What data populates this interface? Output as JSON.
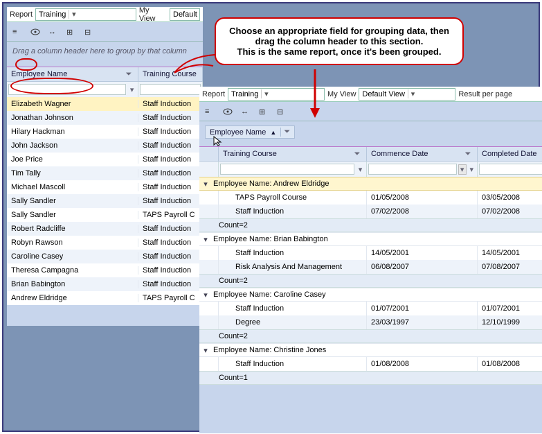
{
  "callout": {
    "line1": "Choose an appropriate field for grouping data, then",
    "line2": "drag the column header to this section.",
    "line3": "This is the same report, once it's been grouped."
  },
  "left": {
    "reportLabel": "Report",
    "reportValue": "Training",
    "myViewLabel": "My View",
    "myViewValue": "Default",
    "groupHint": "Drag a column header here to group by that column",
    "columns": {
      "c1": "Employee Name",
      "c2": "Training Course"
    },
    "rows": [
      {
        "name": "Elizabeth Wagner",
        "course": "Staff Induction"
      },
      {
        "name": "Jonathan Johnson",
        "course": "Staff Induction"
      },
      {
        "name": "Hilary Hackman",
        "course": "Staff Induction"
      },
      {
        "name": "John Jackson",
        "course": "Staff Induction"
      },
      {
        "name": "Joe Price",
        "course": "Staff Induction"
      },
      {
        "name": "Tim Tally",
        "course": "Staff Induction"
      },
      {
        "name": "Michael Mascoll",
        "course": "Staff Induction"
      },
      {
        "name": "Sally Sandler",
        "course": "Staff Induction"
      },
      {
        "name": "Sally Sandler",
        "course": "TAPS Payroll C"
      },
      {
        "name": "Robert Radcliffe",
        "course": "Staff Induction"
      },
      {
        "name": "Robyn Rawson",
        "course": "Staff Induction"
      },
      {
        "name": "Caroline Casey",
        "course": "Staff Induction"
      },
      {
        "name": "Theresa Campagna",
        "course": "Staff Induction"
      },
      {
        "name": "Brian Babington",
        "course": "Staff Induction"
      },
      {
        "name": "Andrew Eldridge",
        "course": "TAPS Payroll C"
      }
    ]
  },
  "right": {
    "reportLabel": "Report",
    "reportValue": "Training",
    "myViewLabel": "My View",
    "myViewValue": "Default View",
    "resultLabel": "Result per page",
    "groupedBy": "Employee Name",
    "sortIndicator": "▲",
    "columns": {
      "c1": "Training Course",
      "c2": "Commence Date",
      "c3": "Completed Date"
    },
    "groups": [
      {
        "label": "Employee Name: Andrew Eldridge",
        "highlighted": true,
        "rows": [
          {
            "course": "TAPS Payroll Course",
            "start": "01/05/2008",
            "end": "03/05/2008"
          },
          {
            "course": "Staff Induction",
            "start": "07/02/2008",
            "end": "07/02/2008"
          }
        ],
        "count": "Count=2"
      },
      {
        "label": "Employee Name: Brian Babington",
        "rows": [
          {
            "course": "Staff Induction",
            "start": "14/05/2001",
            "end": "14/05/2001"
          },
          {
            "course": "Risk Analysis And Management",
            "start": "06/08/2007",
            "end": "07/08/2007"
          }
        ],
        "count": "Count=2"
      },
      {
        "label": "Employee Name: Caroline Casey",
        "rows": [
          {
            "course": "Staff Induction",
            "start": "01/07/2001",
            "end": "01/07/2001"
          },
          {
            "course": "Degree",
            "start": "23/03/1997",
            "end": "12/10/1999"
          }
        ],
        "count": "Count=2"
      },
      {
        "label": "Employee Name: Christine Jones",
        "rows": [
          {
            "course": "Staff Induction",
            "start": "01/08/2008",
            "end": "01/08/2008"
          }
        ],
        "count": "Count=1"
      }
    ]
  }
}
